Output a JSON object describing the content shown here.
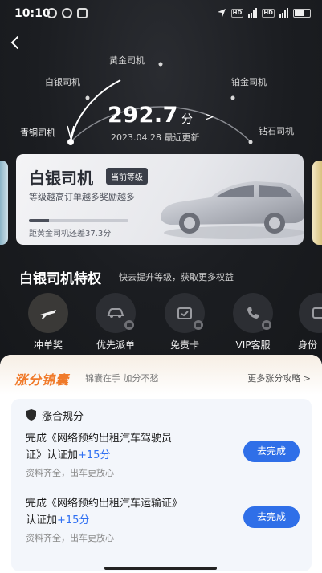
{
  "status_bar": {
    "time": "10:10"
  },
  "gauge": {
    "levels": [
      "青铜司机",
      "白银司机",
      "黄金司机",
      "铂金司机",
      "钻石司机"
    ],
    "score": "292.7",
    "score_unit": "分",
    "updated": "2023.04.28 最近更新"
  },
  "level_card": {
    "title": "白银司机",
    "badge": "当前等级",
    "desc": "等级越高订单越多奖励越多",
    "progress": 0.2,
    "remaining": "距黄金司机还差37.3分"
  },
  "privileges": {
    "title": "白银司机特权",
    "subtitle": "快去提升等级，获取更多权益",
    "items": [
      {
        "label": "冲单奖",
        "icon": "plane-icon",
        "locked": false
      },
      {
        "label": "优先派单",
        "icon": "car-icon",
        "locked": true
      },
      {
        "label": "免责卡",
        "icon": "card-icon",
        "locked": true
      },
      {
        "label": "VIP客服",
        "icon": "phone-icon",
        "locked": true
      },
      {
        "label": "身份",
        "icon": "id-icon",
        "locked": true
      }
    ]
  },
  "sheet": {
    "brand": "涨分锦囊",
    "brand_sub": "锦囊在手 加分不愁",
    "more": "更多涨分攻略 >",
    "panel_title": "涨合规分",
    "tasks": [
      {
        "text_1": "完成《网络预约出租汽车驾驶员",
        "text_2": "证》认证加",
        "plus": "+15分",
        "hint": "资料齐全，出车更放心",
        "button": "去完成"
      },
      {
        "text_1": "完成《网络预约出租汽车运输证》",
        "text_2": "认证加",
        "plus": "+15分",
        "hint": "资料齐全，出车更放心",
        "button": "去完成"
      }
    ]
  },
  "colors": {
    "accent": "#2f6fe8",
    "brand": "#f07a2a",
    "bg_dark": "#17191d"
  }
}
